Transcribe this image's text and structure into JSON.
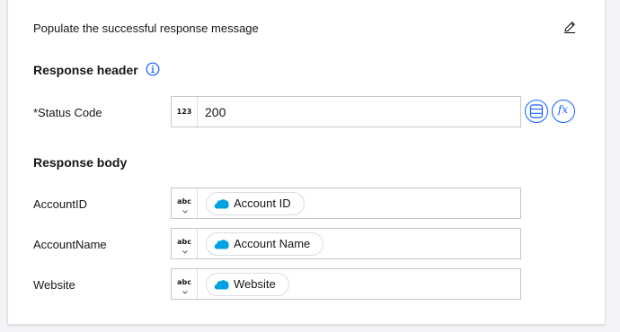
{
  "description": "Populate the successful response message",
  "response_header": {
    "title": "Response header",
    "fields": [
      {
        "label": "*Status Code",
        "type_badge": "123",
        "value": "200"
      }
    ],
    "actions": {
      "mapping_icon": "list-mapping-icon",
      "function_label": "fx"
    }
  },
  "response_body": {
    "title": "Response body",
    "fields": [
      {
        "label": "AccountID",
        "type_badge": "abc",
        "pill": "Account ID"
      },
      {
        "label": "AccountName",
        "type_badge": "abc",
        "pill": "Account Name"
      },
      {
        "label": "Website",
        "type_badge": "abc",
        "pill": "Website"
      }
    ]
  },
  "icons": [
    "edit-icon",
    "info-icon",
    "salesforce-cloud-icon",
    "chevron-down-icon"
  ],
  "colors": {
    "accent": "#0f62fe",
    "salesforce": "#00a1e0",
    "border": "#c6c6c6"
  }
}
